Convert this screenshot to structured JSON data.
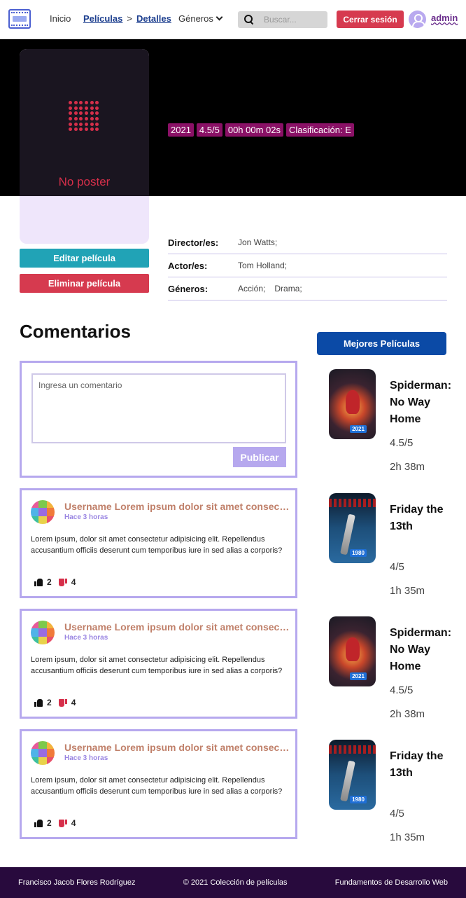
{
  "nav": {
    "inicio": "Inicio",
    "breadcrumb": [
      "Películas",
      "Detalles"
    ],
    "breadcrumb_sep": ">",
    "generos": "Géneros",
    "search_placeholder": "Buscar...",
    "logout": "Cerrar sesión",
    "username": "admin"
  },
  "movie": {
    "poster_label": "No poster",
    "tags": [
      "2021",
      "4.5/5",
      "00h 00m 02s",
      "Clasificación: E"
    ],
    "details": [
      {
        "label": "Director/es:",
        "values": [
          "Jon Watts;"
        ]
      },
      {
        "label": "Actor/es:",
        "values": [
          "Tom Holland;"
        ]
      },
      {
        "label": "Géneros:",
        "values": [
          "Acción;",
          "Drama;"
        ]
      }
    ]
  },
  "actions": {
    "edit": "Editar película",
    "delete": "Eliminar película"
  },
  "comments": {
    "title": "Comentarios",
    "placeholder": "Ingresa un comentario",
    "publish": "Publicar",
    "items": [
      {
        "username": "Username Lorem ipsum dolor sit amet consectetur",
        "time": "Hace 3 horas",
        "body": "Lorem ipsum, dolor sit amet consectetur adipisicing elit. Repellendus accusantium officiis deserunt cum temporibus iure in sed alias a corporis?",
        "likes": "2",
        "dislikes": "4"
      },
      {
        "username": "Username Lorem ipsum dolor sit amet consectetur",
        "time": "Hace 3 horas",
        "body": "Lorem ipsum, dolor sit amet consectetur adipisicing elit. Repellendus accusantium officiis deserunt cum temporibus iure in sed alias a corporis?",
        "likes": "2",
        "dislikes": "4"
      },
      {
        "username": "Username Lorem ipsum dolor sit amet consectetur",
        "time": "Hace 3 horas",
        "body": "Lorem ipsum, dolor sit amet consectetur adipisicing elit. Repellendus accusantium officiis deserunt cum temporibus iure in sed alias a corporis?",
        "likes": "2",
        "dislikes": "4"
      }
    ]
  },
  "best": {
    "button": "Mejores Películas",
    "movies": [
      {
        "title": "Spiderman: No Way Home",
        "year": "2021",
        "rating": "4.5/5",
        "duration": "2h 38m",
        "poster": "spiderman-poster"
      },
      {
        "title": "Friday the 13th",
        "year": "1980",
        "rating": "4/5",
        "duration": "1h 35m",
        "poster": "friday-poster"
      },
      {
        "title": "Spiderman: No Way Home",
        "year": "2021",
        "rating": "4.5/5",
        "duration": "2h 38m",
        "poster": "spiderman-poster"
      },
      {
        "title": "Friday the 13th",
        "year": "1980",
        "rating": "4/5",
        "duration": "1h 35m",
        "poster": "friday-poster"
      }
    ]
  },
  "footer": {
    "left": "Francisco Jacob Flores Rodríguez",
    "center": "© 2021 Colección de películas",
    "right": "Fundamentos de Desarrollo Web"
  },
  "colors": {
    "accent": "#b6a8ee",
    "danger": "#d63a4f",
    "info": "#21a3b6",
    "primary": "#0b4aa6",
    "tag": "#8a1166",
    "footer": "#280a3d"
  }
}
